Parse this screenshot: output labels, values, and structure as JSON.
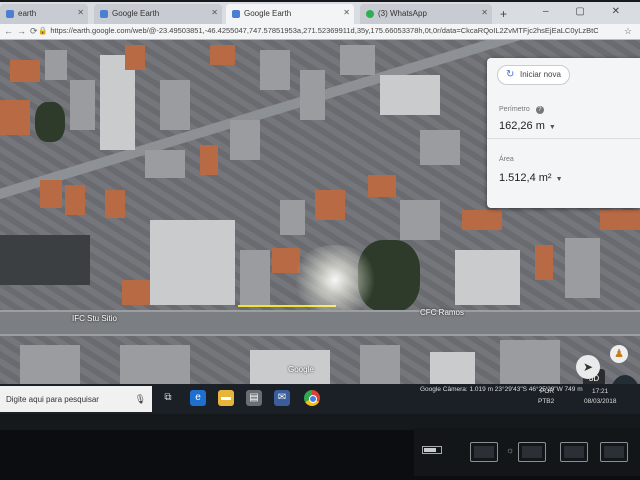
{
  "browser": {
    "tabs": [
      {
        "label": "earth"
      },
      {
        "label": "Google Earth"
      },
      {
        "label": "Google Earth"
      },
      {
        "label": "(3) WhatsApp"
      }
    ],
    "url": "https://earth.google.com/web/@-23.49503851,-46.4255047,747.57851953a,271.52369911d,35y,175.66053378h,0t,0r/data=CkcaRQoIL2ZvMTFjc2hsEjEaLC0yLzBtOWxnZXZj",
    "new_tab_symbol": "+",
    "window_controls": "–  ▢  ✕"
  },
  "map": {
    "labels": {
      "left_road": "IFC Stu Sitio",
      "right_road": "CFC Ramos",
      "center": "Google"
    }
  },
  "measure": {
    "restart_label": "Iniciar nova",
    "perimeter_label": "Perímetro",
    "perimeter_value": "162,26 m",
    "area_label": "Área",
    "area_value": "1.512,4 m²"
  },
  "controls": {
    "three_d": "3D"
  },
  "ge_status": "Google  Câmera: 1.019 m  23°29'43\"S 46°25'29\"W  749 m",
  "taskbar": {
    "search_placeholder": "Digite aqui para pesquisar",
    "language_top": "POR",
    "language_bottom": "PTB2",
    "time": "17:21",
    "date": "08/03/2018"
  }
}
